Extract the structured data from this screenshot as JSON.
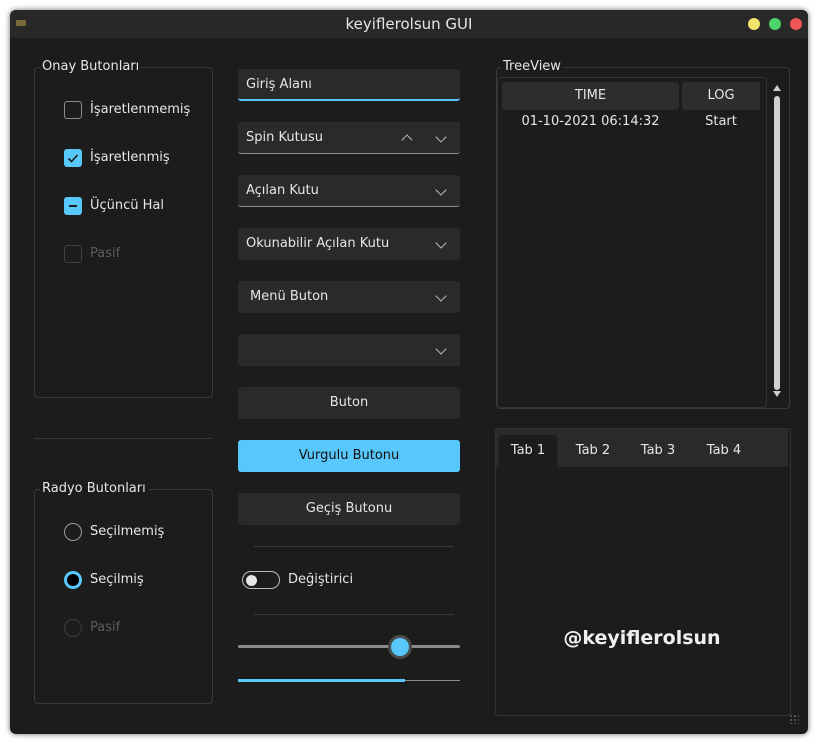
{
  "window": {
    "title": "keyiflerolsun GUI"
  },
  "checkbox_group": {
    "title": "Onay Butonları",
    "items": [
      {
        "label": "İşaretlenmemiş",
        "state": "unchecked"
      },
      {
        "label": "İşaretlenmiş",
        "state": "checked"
      },
      {
        "label": "Üçüncü Hal",
        "state": "partial"
      },
      {
        "label": "Pasif",
        "state": "disabled"
      }
    ]
  },
  "radio_group": {
    "title": "Radyo Butonları",
    "items": [
      {
        "label": "Seçilmemiş",
        "state": "unselected"
      },
      {
        "label": "Seçilmiş",
        "state": "selected"
      },
      {
        "label": "Pasif",
        "state": "disabled"
      }
    ]
  },
  "inputs": {
    "line_edit": "Giriş Alanı",
    "spin_box": "Spin Kutusu",
    "combo_box": "Açılan Kutu",
    "readonly_combo": "Okunabilir Açılan Kutu",
    "menu_button": "Menü Buton",
    "empty_combo": ""
  },
  "buttons": {
    "button": "Buton",
    "accent_button": "Vurgulu Butonu",
    "toggle_button": "Geçiş Butonu"
  },
  "switch": {
    "label": "Değiştirici",
    "on": false
  },
  "slider": {
    "value_fraction": 0.73
  },
  "progress": {
    "value_fraction": 0.75
  },
  "treeview": {
    "title": "TreeView",
    "columns": [
      "TIME",
      "LOG"
    ],
    "rows": [
      [
        "01-10-2021 06:14:32",
        "Start"
      ]
    ]
  },
  "tabs": {
    "labels": [
      "Tab 1",
      "Tab 2",
      "Tab 3",
      "Tab 4"
    ],
    "active_index": 0,
    "content": "@keyiflerolsun"
  },
  "colors": {
    "accent": "#58c7fb",
    "background": "#1c1c1c",
    "surface": "#2a2a2a"
  }
}
